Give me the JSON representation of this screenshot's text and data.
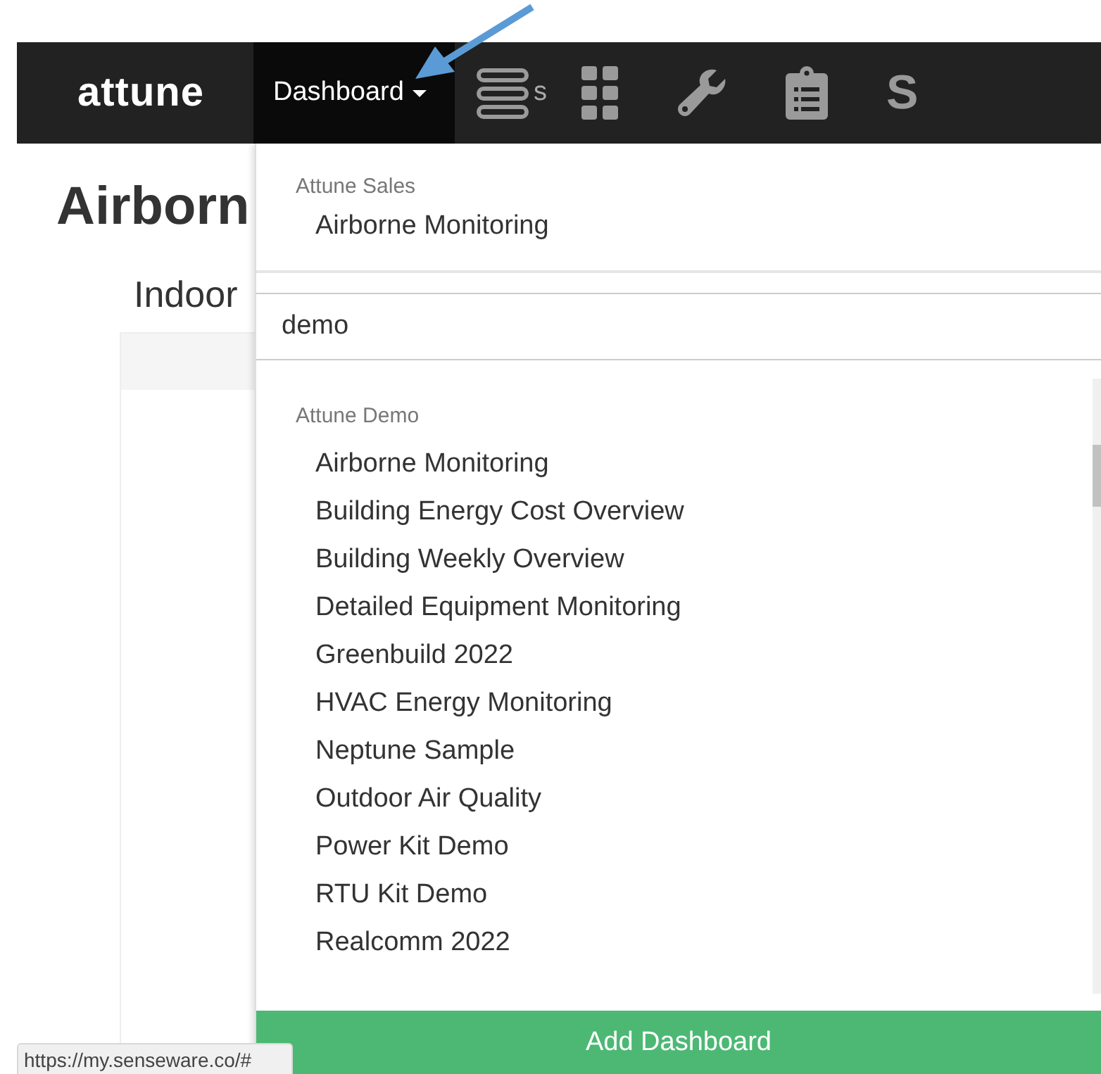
{
  "nav": {
    "logo": "attune",
    "tab": {
      "label": "Dashboard",
      "selected": true
    },
    "icons": [
      {
        "kind": "list",
        "label": "s"
      },
      {
        "kind": "grid"
      },
      {
        "kind": "wrench"
      },
      {
        "kind": "clipboard"
      },
      {
        "kind": "letter",
        "label": "S"
      }
    ]
  },
  "page": {
    "title": "Airborn",
    "subtitle": "Indoor"
  },
  "dropdown": {
    "groups": [
      {
        "label": "Attune Sales",
        "items": [
          "Airborne Monitoring"
        ]
      }
    ],
    "search": {
      "value": "demo"
    },
    "results": [
      {
        "label": "Attune Demo",
        "items": [
          "Airborne Monitoring",
          "Building Energy Cost Overview",
          "Building Weekly Overview",
          "Detailed Equipment Monitoring",
          "Greenbuild 2022",
          "HVAC Energy Monitoring",
          "Neptune Sample",
          "Outdoor Air Quality",
          "Power Kit Demo",
          "RTU Kit Demo",
          "Realcomm 2022"
        ]
      }
    ],
    "button": "Add Dashboard"
  },
  "status_url": "https://my.senseware.co/#"
}
